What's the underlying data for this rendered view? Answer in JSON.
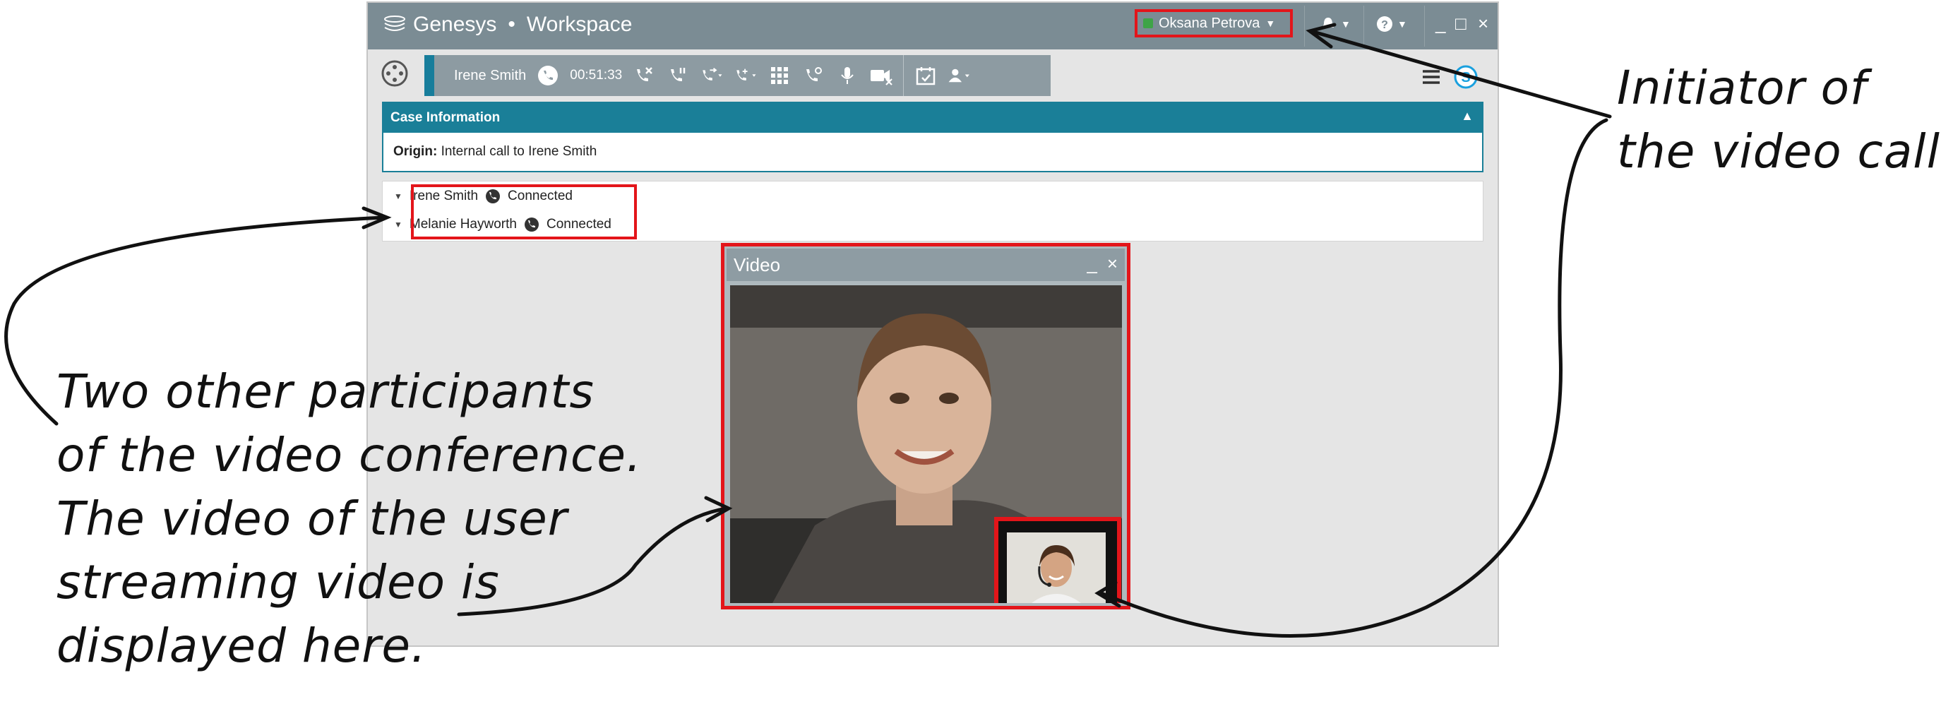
{
  "app": {
    "brand": "Genesys",
    "separator": "•",
    "product": "Workspace",
    "agent_name": "Oksana Petrova",
    "window_controls": [
      "_",
      "□",
      "×"
    ]
  },
  "toolbar": {
    "party_name": "Irene Smith",
    "call_duration": "00:51:33"
  },
  "case_info": {
    "header": "Case Information",
    "origin_label": "Origin:",
    "origin_value": "Internal call to Irene Smith"
  },
  "participants": [
    {
      "name": "Irene Smith",
      "status": "Connected"
    },
    {
      "name": "Melanie Hayworth",
      "status": "Connected"
    }
  ],
  "video_window": {
    "title": "Video",
    "minimize": "_",
    "close": "×"
  },
  "annotations": {
    "initiator_line1": "Initiator of",
    "initiator_line2": "the video call",
    "participants_line1": "Two other participants",
    "participants_line2": "of the video conference.",
    "participants_line3": "The video of the user",
    "participants_line4": "streaming video is",
    "participants_line5": "displayed here."
  },
  "colors": {
    "titlebar": "#7b8c94",
    "case_header": "#1a7f98",
    "call_accent": "#177d9b",
    "highlight": "#e3151a",
    "status_ready": "#3ea447"
  },
  "icons": {
    "call_state": "phone-icon",
    "end_call": "end-call-icon",
    "hold": "hold-icon",
    "transfer": "transfer-icon",
    "conference": "conference-icon",
    "dialpad": "dialpad-icon",
    "consult": "consult-icon",
    "mute": "microphone-icon",
    "video_off": "video-off-icon",
    "schedule": "schedule-icon",
    "party": "party-action-icon",
    "menu": "menu-icon",
    "skype": "skype-icon"
  }
}
